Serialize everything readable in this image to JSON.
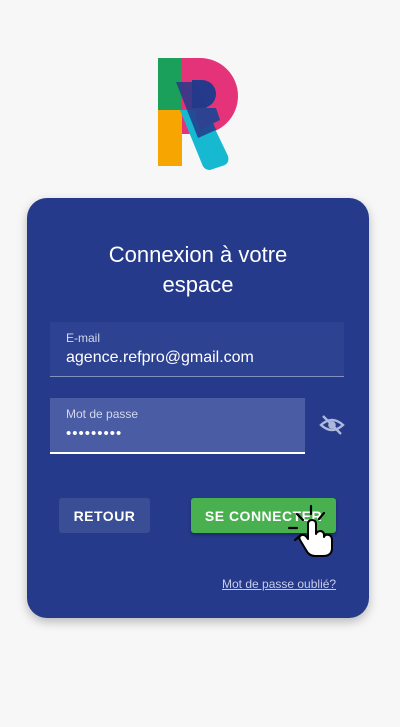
{
  "login": {
    "title_line1": "Connexion à votre",
    "title_line2": "espace",
    "email": {
      "label": "E-mail",
      "value": "agence.refpro@gmail.com"
    },
    "password": {
      "label": "Mot de passe",
      "value": "•••••••••"
    },
    "back_label": "RETOUR",
    "submit_label": "SE CONNECTER",
    "forgot_label": "Mot de passe oublié?"
  },
  "icons": {
    "logo": "r-logo-icon",
    "password_visibility": "eye-slash-icon",
    "pointer": "hand-pointer-icon"
  },
  "colors": {
    "background": "#f7f7f8",
    "card": "#253a8a",
    "primary_button": "#49b04f",
    "secondary_button": "#3a4e96"
  }
}
